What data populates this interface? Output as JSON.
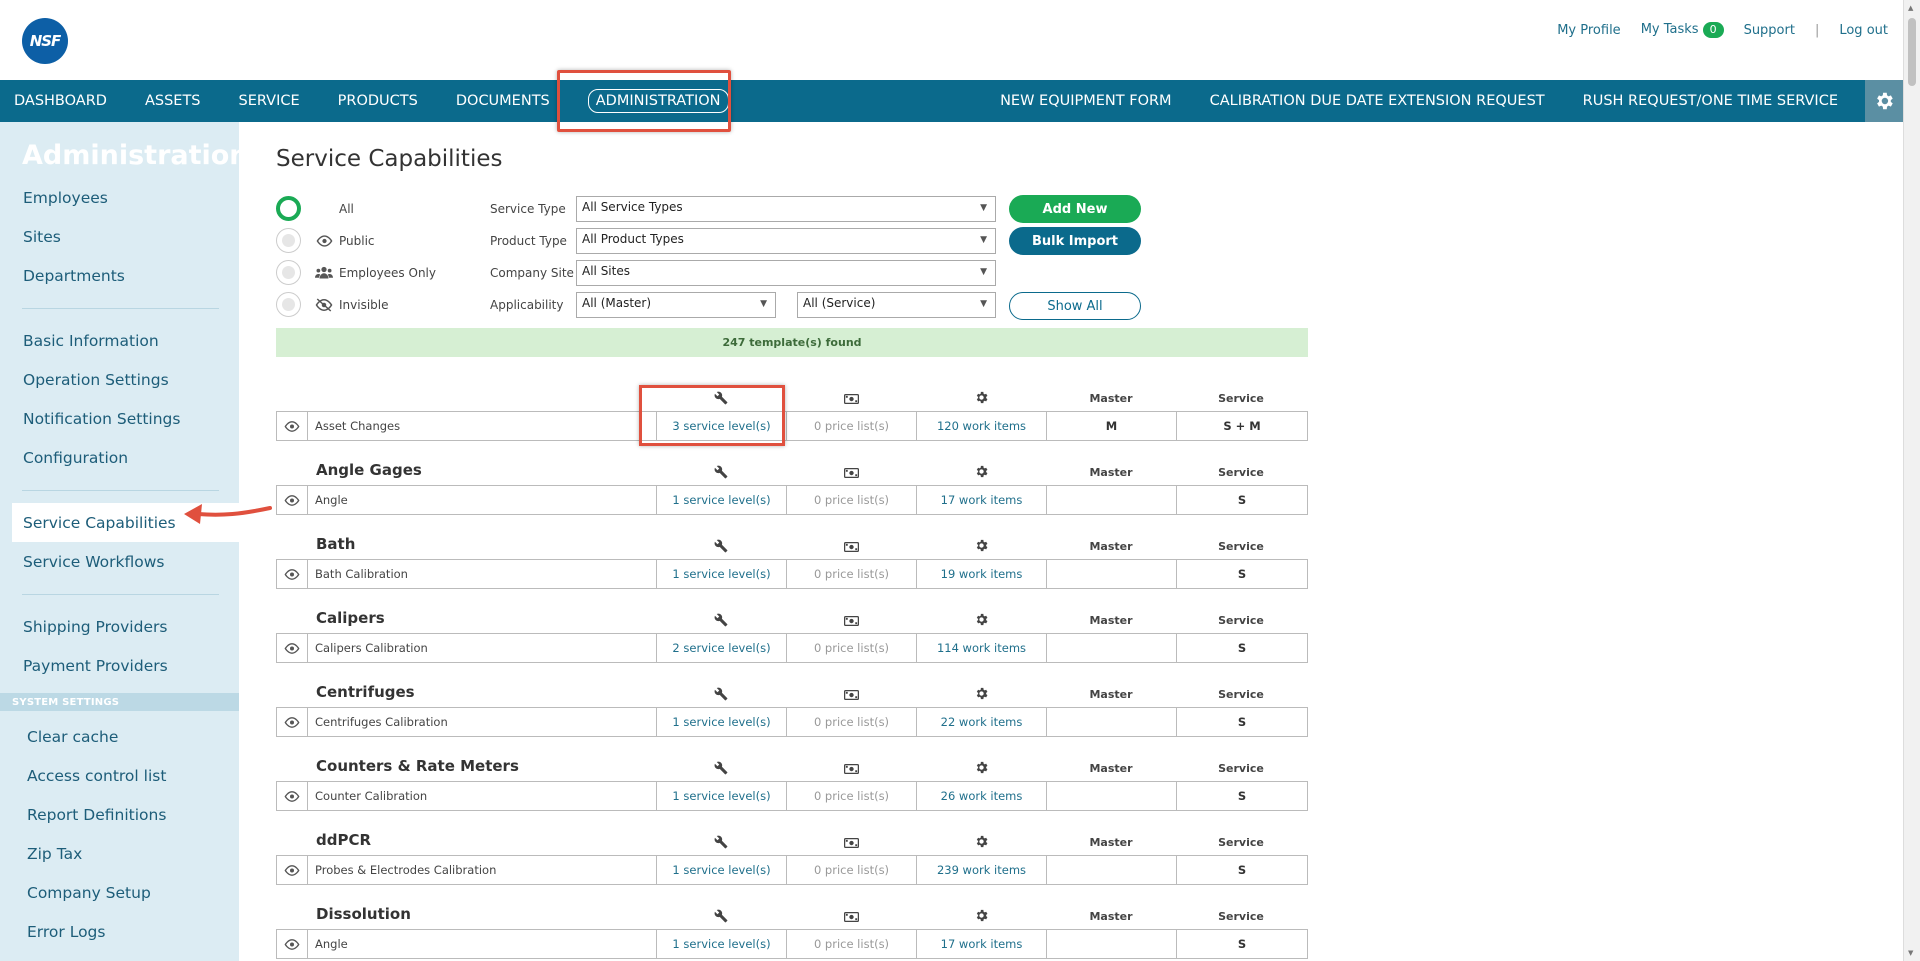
{
  "header": {
    "logo_text": "NSF",
    "links": {
      "profile": "My Profile",
      "tasks": "My Tasks",
      "tasks_count": "0",
      "support": "Support",
      "sep": "|",
      "logout": "Log out"
    }
  },
  "nav": {
    "left": [
      "DASHBOARD",
      "ASSETS",
      "SERVICE",
      "PRODUCTS",
      "DOCUMENTS",
      "ADMINISTRATION"
    ],
    "right": [
      "NEW EQUIPMENT FORM",
      "CALIBRATION DUE DATE EXTENSION REQUEST",
      "RUSH REQUEST/ONE TIME SERVICE"
    ],
    "active": "ADMINISTRATION"
  },
  "sidebar": {
    "title": "Administration",
    "group1": [
      "Employees",
      "Sites",
      "Departments"
    ],
    "group2": [
      "Basic Information",
      "Operation Settings",
      "Notification Settings",
      "Configuration"
    ],
    "group3": [
      "Service Capabilities",
      "Service Workflows"
    ],
    "group4": [
      "Shipping Providers",
      "Payment Providers"
    ],
    "system_title": "SYSTEM SETTINGS",
    "system": [
      "Clear cache",
      "Access control list",
      "Report Definitions",
      "Zip Tax",
      "Company Setup",
      "Error Logs"
    ]
  },
  "page": {
    "title": "Service Capabilities",
    "visibility": [
      "All",
      "Public",
      "Employees Only",
      "Invisible"
    ],
    "filters": {
      "service_type_label": "Service Type",
      "service_type": "All Service Types",
      "product_type_label": "Product Type",
      "product_type": "All Product Types",
      "company_site_label": "Company Site",
      "company_site": "All Sites",
      "applicability_label": "Applicability",
      "applicability_master": "All (Master)",
      "applicability_service": "All (Service)"
    },
    "buttons": {
      "add_new": "Add New",
      "bulk_import": "Bulk Import",
      "show_all": "Show All"
    },
    "found": "247 template(s) found",
    "col_master": "Master",
    "col_service": "Service"
  },
  "groups": [
    {
      "name": "",
      "row": {
        "name": "Asset Changes",
        "svc": "3 service level(s)",
        "price": "0 price list(s)",
        "work": "120 work items",
        "master": "M",
        "service": "S + M"
      }
    },
    {
      "name": "Angle Gages",
      "row": {
        "name": "Angle",
        "svc": "1 service level(s)",
        "price": "0 price list(s)",
        "work": "17 work items",
        "master": "",
        "service": "S"
      }
    },
    {
      "name": "Bath",
      "row": {
        "name": "Bath Calibration",
        "svc": "1 service level(s)",
        "price": "0 price list(s)",
        "work": "19 work items",
        "master": "",
        "service": "S"
      }
    },
    {
      "name": "Calipers",
      "row": {
        "name": "Calipers Calibration",
        "svc": "2 service level(s)",
        "price": "0 price list(s)",
        "work": "114 work items",
        "master": "",
        "service": "S"
      }
    },
    {
      "name": "Centrifuges",
      "row": {
        "name": "Centrifuges Calibration",
        "svc": "1 service level(s)",
        "price": "0 price list(s)",
        "work": "22 work items",
        "master": "",
        "service": "S"
      }
    },
    {
      "name": "Counters & Rate Meters",
      "row": {
        "name": "Counter Calibration",
        "svc": "1 service level(s)",
        "price": "0 price list(s)",
        "work": "26 work items",
        "master": "",
        "service": "S"
      }
    },
    {
      "name": "ddPCR",
      "row": {
        "name": "Probes & Electrodes Calibration",
        "svc": "1 service level(s)",
        "price": "0 price list(s)",
        "work": "239 work items",
        "master": "",
        "service": "S"
      }
    },
    {
      "name": "Dissolution",
      "row": {
        "name": "Angle",
        "svc": "1 service level(s)",
        "price": "0 price list(s)",
        "work": "17 work items",
        "master": "",
        "service": "S"
      }
    }
  ]
}
